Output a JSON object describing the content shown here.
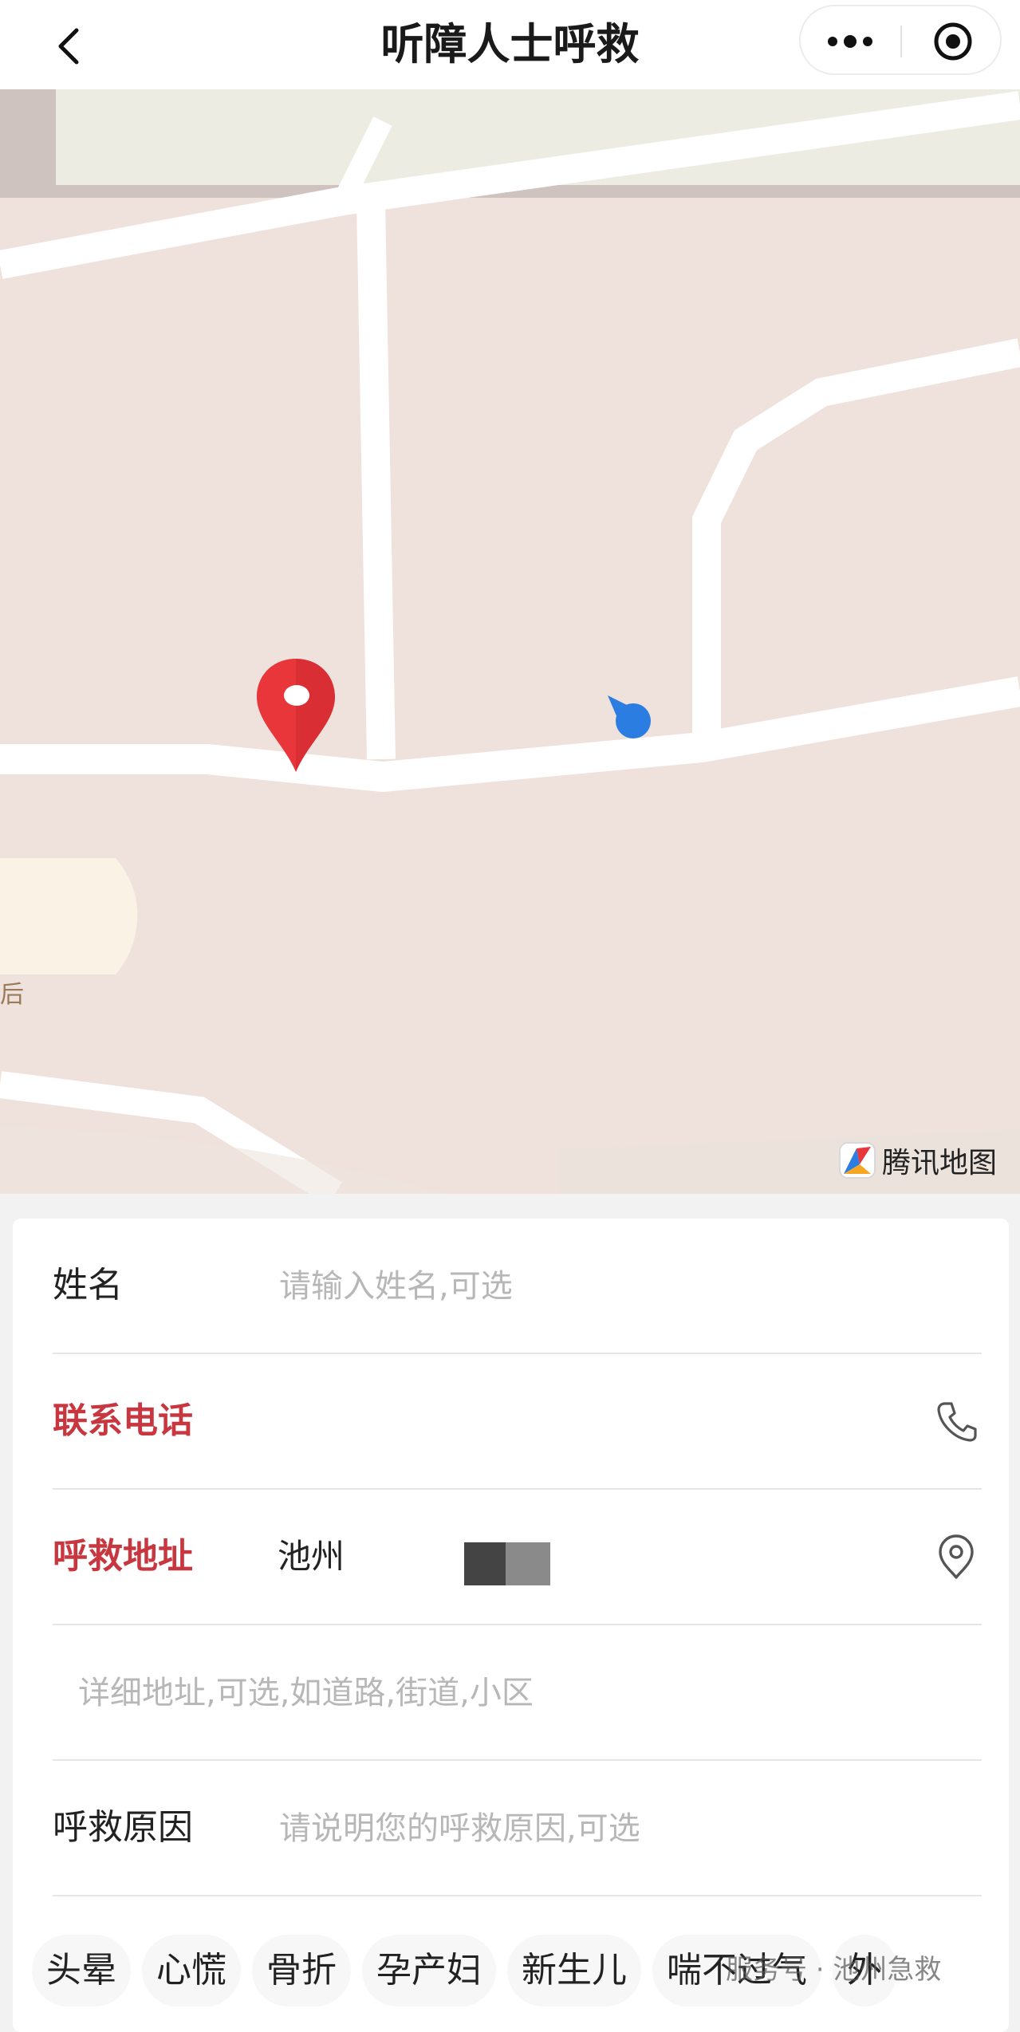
{
  "header": {
    "title": "听障人士呼救",
    "back_icon": "chevron-left-icon",
    "more_icon": "more-dots-icon",
    "target_icon": "target-circle-icon"
  },
  "map": {
    "provider_logo_text": "腾讯地图",
    "edge_text": "后",
    "marker_icon": "location-pin-icon",
    "my_location_icon": "my-location-dot-icon"
  },
  "form": {
    "name": {
      "label": "姓名",
      "placeholder": "请输入姓名,可选",
      "value": ""
    },
    "phone": {
      "label": "联系电话",
      "placeholder": "",
      "value": "",
      "icon": "phone-icon"
    },
    "address": {
      "label": "呼救地址",
      "value": "池州",
      "icon": "location-pin-icon"
    },
    "detail_address": {
      "placeholder": "详细地址,可选,如道路,街道,小区",
      "value": ""
    },
    "reason": {
      "label": "呼救原因",
      "placeholder": "请说明您的呼救原因,可选",
      "value": ""
    },
    "quick_tags": [
      "头晕",
      "心慌",
      "骨折",
      "孕产妇",
      "新生儿",
      "喘不过气",
      "外"
    ]
  },
  "watermark": "服务号 · 池州急救",
  "colors": {
    "required_label": "#c8373f",
    "map_background": "#efe1dc",
    "road": "#ffffff",
    "marker": "#e8363b",
    "my_location": "#2b7de1"
  }
}
